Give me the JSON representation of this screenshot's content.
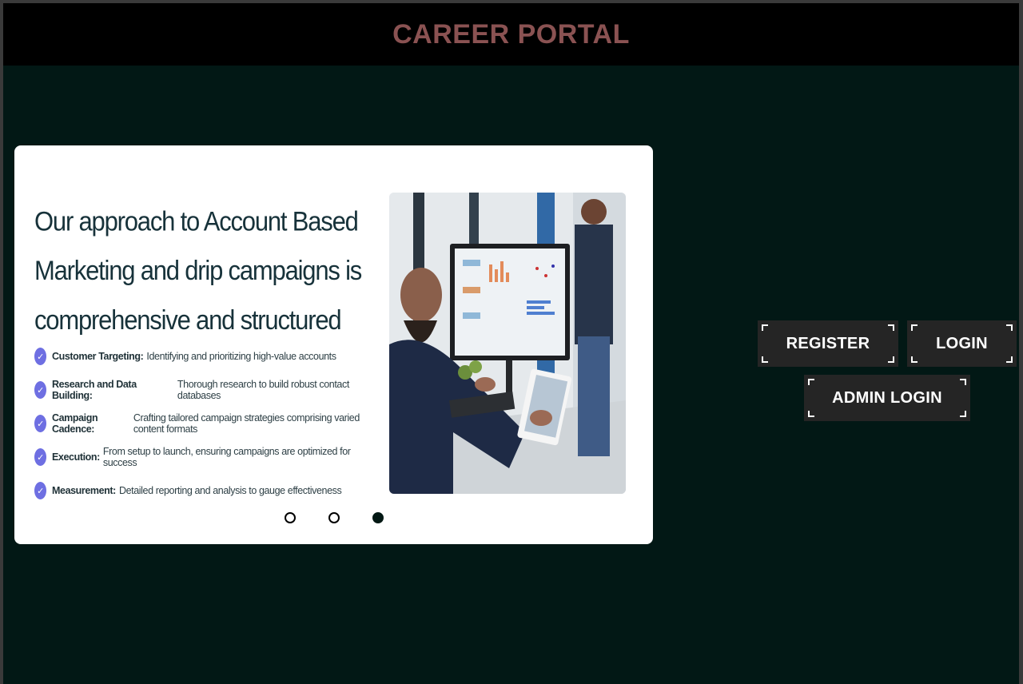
{
  "header": {
    "title": "CAREER PORTAL"
  },
  "slide": {
    "heading": "Our approach to Account Based Marketing and drip campaigns is comprehensive and structured",
    "bullets": [
      {
        "label": "Customer Targeting:",
        "text": "Identifying and prioritizing high-value accounts"
      },
      {
        "label": "Research and Data Building:",
        "text": "Thorough research to build robust contact databases"
      },
      {
        "label": "Campaign Cadence:",
        "text": "Crafting tailored campaign strategies comprising varied content formats"
      },
      {
        "label": "Execution:",
        "text": "From setup to launch, ensuring campaigns are optimized for success"
      },
      {
        "label": "Measurement:",
        "text": "Detailed reporting and analysis to gauge effectiveness"
      }
    ],
    "check_icon": "check-icon",
    "photo_icon": "office-photo",
    "active_dot": 3,
    "dot_count": 3
  },
  "actions": {
    "register": "REGISTER",
    "login": "LOGIN",
    "admin_login": "ADMIN LOGIN"
  },
  "colors": {
    "background": "#021815",
    "header_bg": "#000000",
    "title": "#8a5252",
    "button_bg": "#252525",
    "check": "#6e6fe2"
  }
}
